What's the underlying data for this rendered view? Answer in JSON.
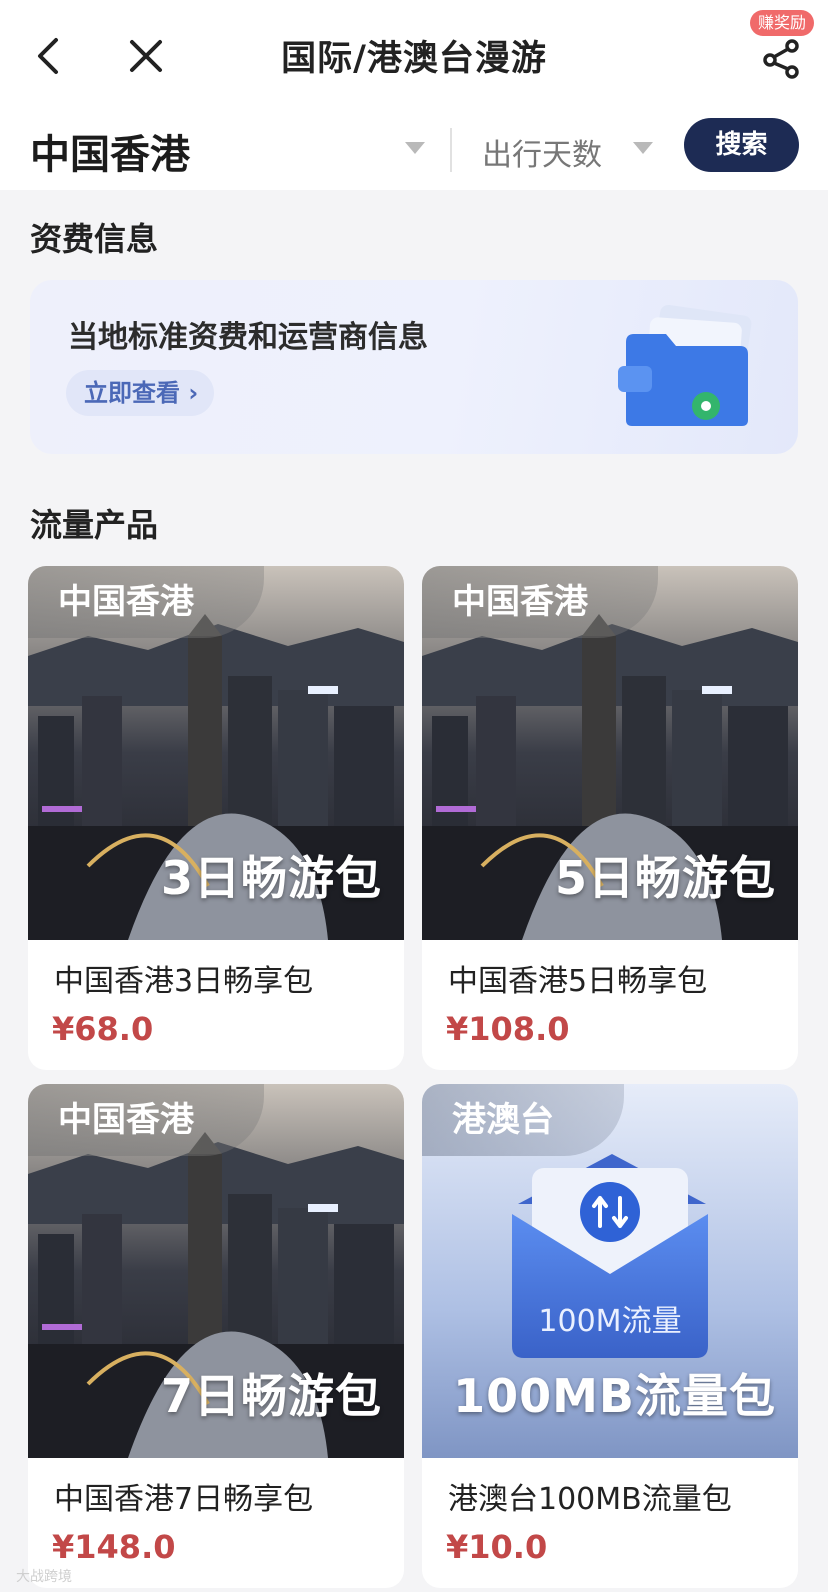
{
  "header": {
    "title": "国际/港澳台漫游",
    "reward_badge": "赚奖励"
  },
  "filter": {
    "region": "中国香港",
    "days_placeholder": "出行天数",
    "search_label": "搜索"
  },
  "tariff": {
    "section_title": "资费信息",
    "card_title": "当地标准资费和运营商信息",
    "view_link": "立即查看"
  },
  "products": {
    "section_title": "流量产品",
    "items": [
      {
        "tag": "中国香港",
        "overlay": "3日畅游包",
        "name": "中国香港3日畅享包",
        "price": "¥68.0"
      },
      {
        "tag": "中国香港",
        "overlay": "5日畅游包",
        "name": "中国香港5日畅享包",
        "price": "¥108.0"
      },
      {
        "tag": "中国香港",
        "overlay": "7日畅游包",
        "name": "中国香港7日畅享包",
        "price": "¥148.0"
      },
      {
        "tag": "港澳台",
        "overlay": "100MB流量包",
        "envelope_label": "100M流量",
        "name": "港澳台100MB流量包",
        "price": "¥10.0"
      }
    ]
  },
  "colors": {
    "search_button": "#1d2b54",
    "price": "#c24848",
    "reward_badge": "#f06a6a"
  },
  "watermark": "大战跨境"
}
